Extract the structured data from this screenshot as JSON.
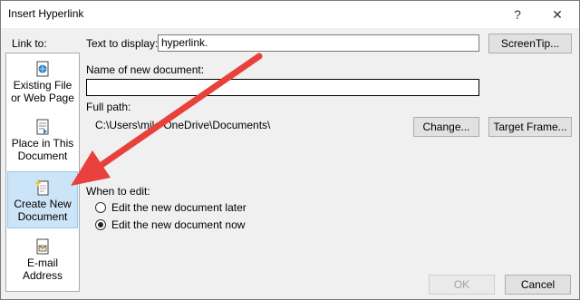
{
  "window": {
    "title": "Insert Hyperlink",
    "help_glyph": "?",
    "close_glyph": "✕"
  },
  "link_to": {
    "label": "Link to:",
    "items": [
      {
        "line1": "Existing File",
        "line2": "or Web Page",
        "icon": "globe-file-icon"
      },
      {
        "line1": "Place in This",
        "line2": "Document",
        "icon": "document-place-icon"
      },
      {
        "line1": "Create New",
        "line2": "Document",
        "icon": "new-document-icon"
      },
      {
        "line1": "E-mail",
        "line2": "Address",
        "icon": "email-icon"
      }
    ],
    "selected_index": 2
  },
  "text_to_display": {
    "label": "Text to display:",
    "value": "hyperlink."
  },
  "screentip_button": "ScreenTip...",
  "name_of_new_document": {
    "label": "Name of new document:",
    "value": ""
  },
  "full_path": {
    "label": "Full path:",
    "value": "C:\\Users\\mile   OneDrive\\Documents\\"
  },
  "change_button": "Change...",
  "target_frame_button": "Target Frame...",
  "when_to_edit": {
    "label": "When to edit:",
    "options": [
      {
        "label": "Edit the new document later",
        "selected": false
      },
      {
        "label": "Edit the new document now",
        "selected": true
      }
    ]
  },
  "ok_button": "OK",
  "cancel_button": "Cancel",
  "annotation": {
    "color": "#e8413b"
  }
}
